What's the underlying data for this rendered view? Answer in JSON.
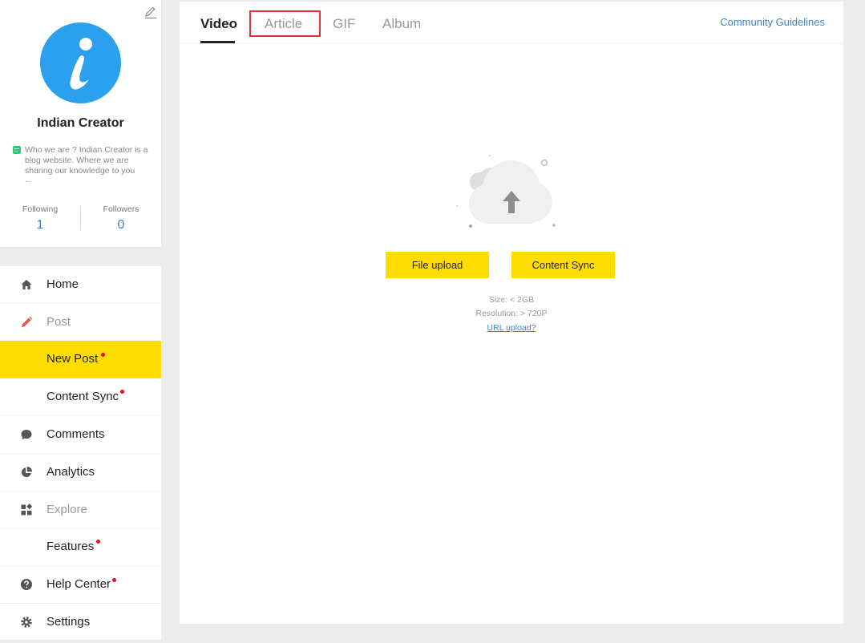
{
  "profile": {
    "name": "Indian Creator",
    "bio": "Who we are ? Indian Creator is a blog website. Where we are sharing our knowledge to you",
    "bio_ellipsis": "...",
    "following_label": "Following",
    "following_count": "1",
    "followers_label": "Followers",
    "followers_count": "0",
    "avatar_letter": "i",
    "avatar_color": "#2aa0ee"
  },
  "nav": {
    "items": [
      {
        "label": "Home",
        "icon": "home-icon"
      },
      {
        "label": "Post",
        "icon": "pencil-icon"
      },
      {
        "label": "New Post",
        "active": true,
        "badge": true
      },
      {
        "label": "Content Sync",
        "badge": true
      },
      {
        "label": "Comments",
        "icon": "comment-icon"
      },
      {
        "label": "Analytics",
        "icon": "pie-chart-icon"
      },
      {
        "label": "Explore",
        "icon": "widgets-icon"
      },
      {
        "label": "Features",
        "badge": true
      },
      {
        "label": "Help Center",
        "icon": "help-icon",
        "badge": true
      },
      {
        "label": "Settings",
        "icon": "gear-icon"
      }
    ],
    "active_color": "#ffdd00",
    "badge_color": "#e0121b"
  },
  "main": {
    "tabs": [
      {
        "label": "Video",
        "active": true
      },
      {
        "label": "Article"
      },
      {
        "label": "GIF"
      },
      {
        "label": "Album"
      }
    ],
    "guidelines": "Community Guidelines",
    "upload_icon": "cloud-upload-icon",
    "file_upload": "File upload",
    "content_sync": "Content Sync",
    "size_info": "Size: < 2GB",
    "resolution_info": "Resolution: > 720P",
    "url_upload": "URL upload?",
    "accent_color": "#ffdd00",
    "link_color": "#3a84c6"
  }
}
